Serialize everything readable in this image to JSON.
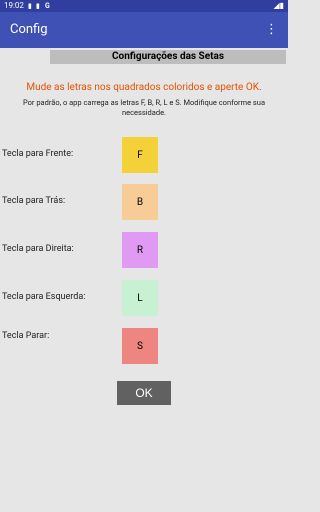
{
  "status": {
    "time": "19:02",
    "icons": [
      "sim-icon",
      "battery-icon",
      "google-icon"
    ]
  },
  "appbar": {
    "title": "Config",
    "menu_icon": "more-vert-icon"
  },
  "section_header": "Configurações das Setas",
  "instruction": "Mude as letras nos quadrados coloridos e aperte OK.",
  "description": "Por padrão, o app carrega as letras F, B, R, L e S. Modifique conforme sua necessidade.",
  "rows": [
    {
      "label": "Tecla para Frente:",
      "key": "F",
      "color": "#f5d139"
    },
    {
      "label": "Tecla para Trás:",
      "key": "B",
      "color": "#f8cc97"
    },
    {
      "label": "Tecla para Direita:",
      "key": "R",
      "color": "#e09af3"
    },
    {
      "label": "Tecla para Esquerda:",
      "key": "L",
      "color": "#c8f0d2"
    },
    {
      "label": "Tecla Parar:",
      "key": "S",
      "color": "#ef8580"
    }
  ],
  "ok_label": "OK"
}
